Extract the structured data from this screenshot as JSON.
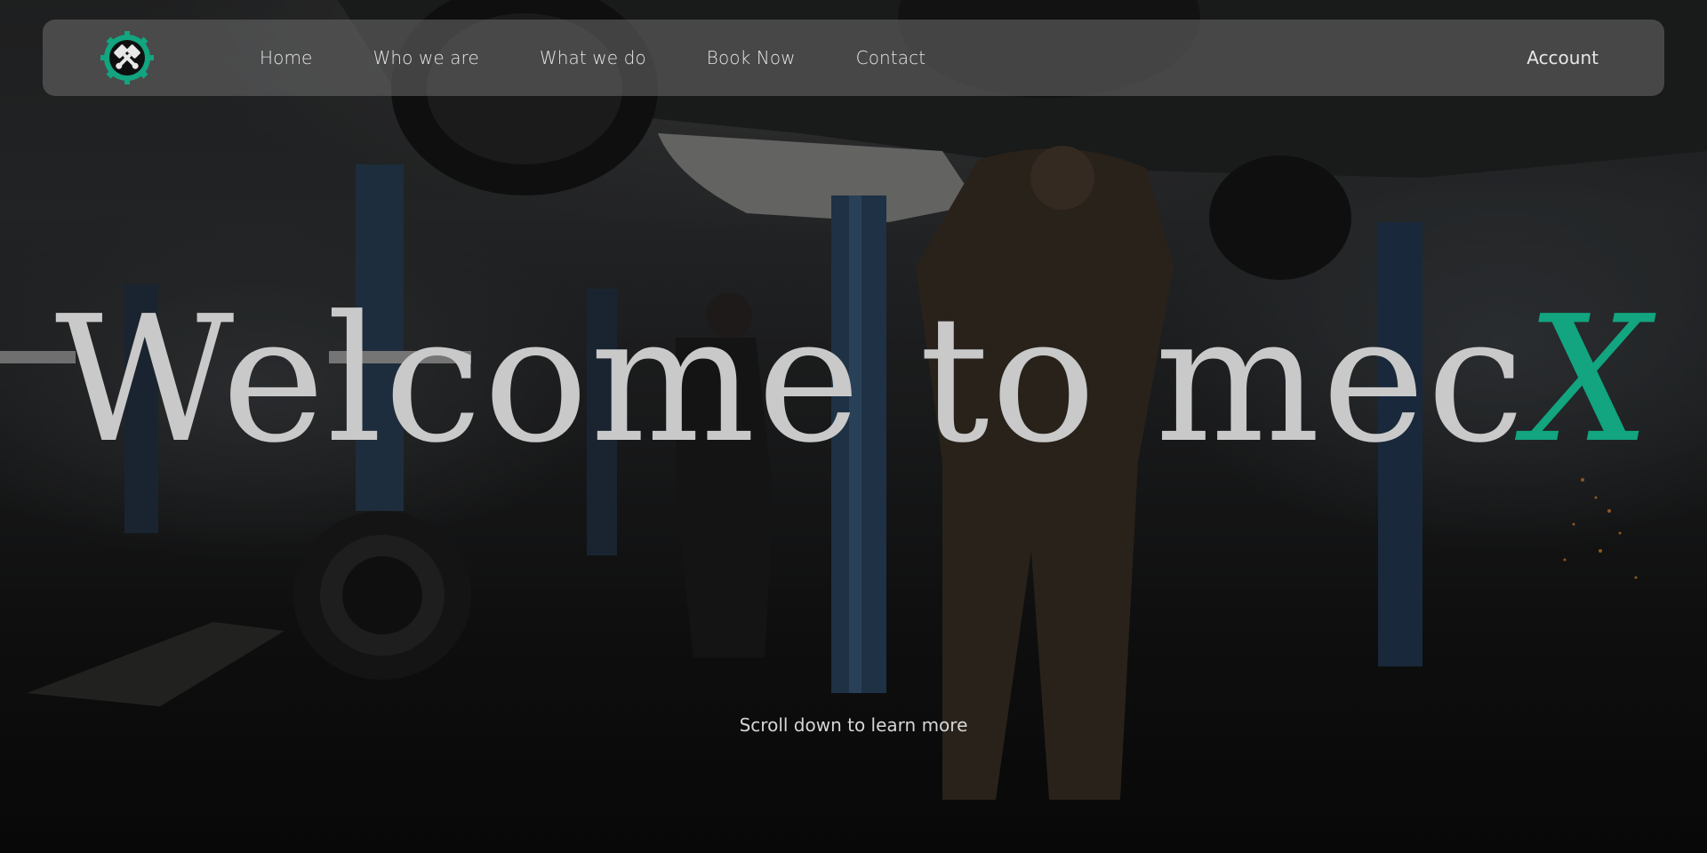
{
  "nav": {
    "logo_icon": "crossed-pistons-gear-icon",
    "items": [
      "Home",
      "Who we are",
      "What we do",
      "Book Now",
      "Contact"
    ],
    "account": "Account"
  },
  "hero": {
    "title_main": "Welcome to mec",
    "title_accent": "X",
    "scroll_hint": "Scroll down to learn more"
  },
  "colors": {
    "accent": "#12a57f",
    "title_text": "#c9c9c9",
    "nav_bg": "rgba(110,110,110,0.55)"
  }
}
